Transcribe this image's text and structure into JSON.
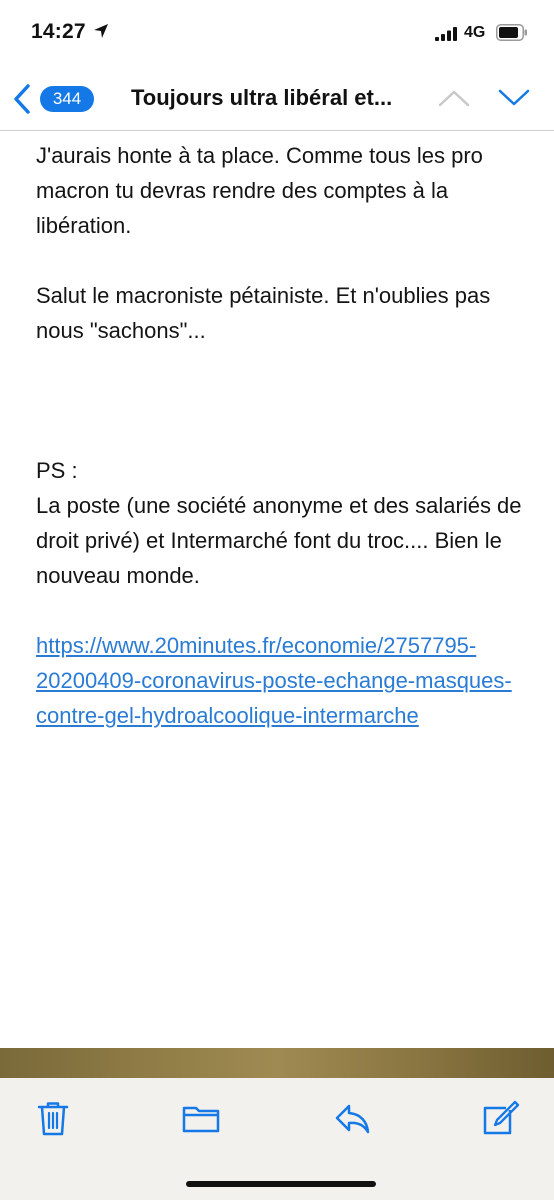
{
  "status_bar": {
    "time": "14:27",
    "network": "4G"
  },
  "nav": {
    "unread_count": "344",
    "title": "Toujours ultra libéral et..."
  },
  "message": {
    "paragraph_1": "J'aurais honte à ta place. Comme tous les pro macron tu devras rendre des comptes à la libération.",
    "paragraph_2": "Salut le macroniste pétainiste. Et n'oublies pas nous \"sachons\"...",
    "ps_label": "PS :",
    "paragraph_3": "La poste (une société anonyme et des salariés de droit privé) et Intermarché font du troc.... Bien le nouveau monde.",
    "link": "https://www.20minutes.fr/economie/2757795-20200409-coronavirus-poste-echange-masques-contre-gel-hydroalcoolique-intermarche"
  },
  "toolbar": {
    "icons": [
      "trash-icon",
      "folder-icon",
      "reply-icon",
      "compose-icon"
    ]
  },
  "colors": {
    "accent": "#1479e6",
    "link": "#2a7bd4"
  }
}
